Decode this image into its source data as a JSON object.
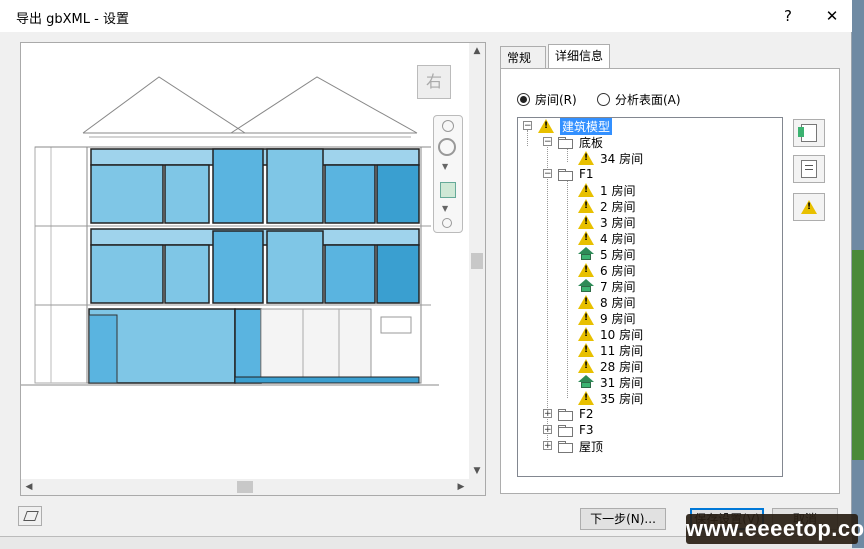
{
  "window": {
    "title": "导出 gbXML - 设置",
    "help_label": "?",
    "close_label": "✕"
  },
  "preview": {
    "viewcube_label": "右"
  },
  "tabs": [
    {
      "label": "常规",
      "active": false
    },
    {
      "label": "详细信息",
      "active": true
    }
  ],
  "radios": [
    {
      "label": "房间(R)",
      "checked": true
    },
    {
      "label": "分析表面(A)",
      "checked": false
    }
  ],
  "tree": {
    "root": "建筑模型",
    "groups": [
      {
        "label": "底板",
        "expanded": true
      },
      {
        "label": "F1",
        "expanded": true
      },
      {
        "label": "F2",
        "expanded": false
      },
      {
        "label": "F3",
        "expanded": false
      },
      {
        "label": "屋顶",
        "expanded": false
      }
    ],
    "floor_items": [
      {
        "label": "34 房间",
        "icon": "warning"
      }
    ],
    "f1_items": [
      {
        "label": "1 房间",
        "icon": "warning"
      },
      {
        "label": "2 房间",
        "icon": "warning"
      },
      {
        "label": "3 房间",
        "icon": "warning"
      },
      {
        "label": "4 房间",
        "icon": "warning"
      },
      {
        "label": "5 房间",
        "icon": "room"
      },
      {
        "label": "6 房间",
        "icon": "warning"
      },
      {
        "label": "7 房间",
        "icon": "room"
      },
      {
        "label": "8 房间",
        "icon": "warning"
      },
      {
        "label": "9 房间",
        "icon": "warning"
      },
      {
        "label": "10 房间",
        "icon": "warning"
      },
      {
        "label": "11 房间",
        "icon": "warning"
      },
      {
        "label": "28 房间",
        "icon": "warning"
      },
      {
        "label": "31 房间",
        "icon": "room"
      },
      {
        "label": "35 房间",
        "icon": "warning"
      }
    ]
  },
  "buttons": {
    "next": "下一步(N)...",
    "save": "保存设置(V)",
    "cancel": "取消"
  },
  "watermark": "www.eeeetop.com",
  "colors": {
    "glass": "#5ab4e0",
    "warning": "#e8c000",
    "room": "#3cb371",
    "selection": "#3390ff"
  }
}
